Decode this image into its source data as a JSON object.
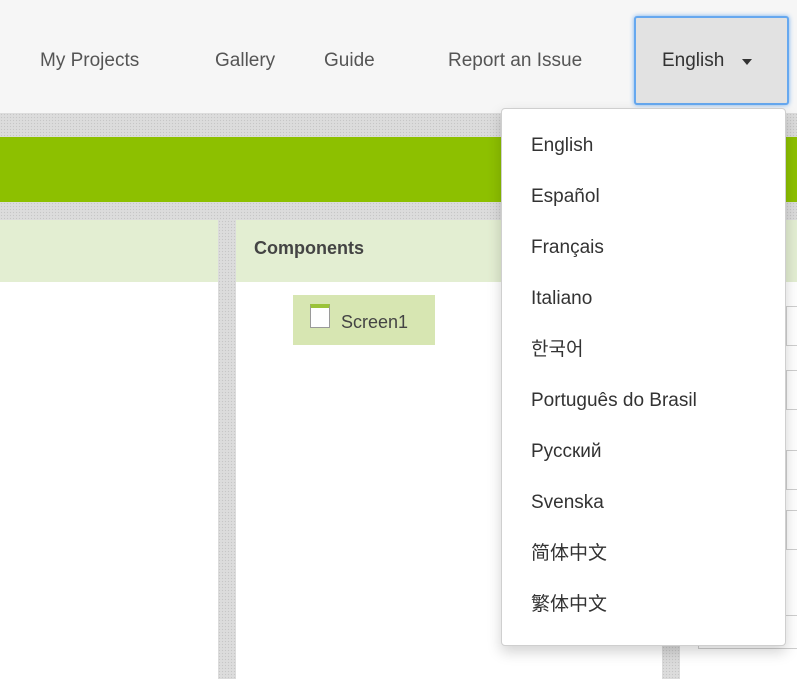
{
  "nav": {
    "my_projects": "My Projects",
    "gallery": "Gallery",
    "guide": "Guide",
    "report_issue": "Report an Issue",
    "language_button": "English"
  },
  "components_panel": {
    "title": "Components",
    "tree": [
      {
        "label": "Screen1",
        "icon": "screen-icon"
      }
    ]
  },
  "language_menu": {
    "items": [
      "English",
      "Español",
      "Français",
      "Italiano",
      "한국어",
      "Português do Brasil",
      "Русский",
      "Svenska",
      "简体中文",
      "繁体中文"
    ]
  },
  "colors": {
    "accent_green": "#8dc000",
    "panel_header": "#e3eed2",
    "selected_item": "#d7e6b2",
    "focus_border": "#66a8ef"
  }
}
